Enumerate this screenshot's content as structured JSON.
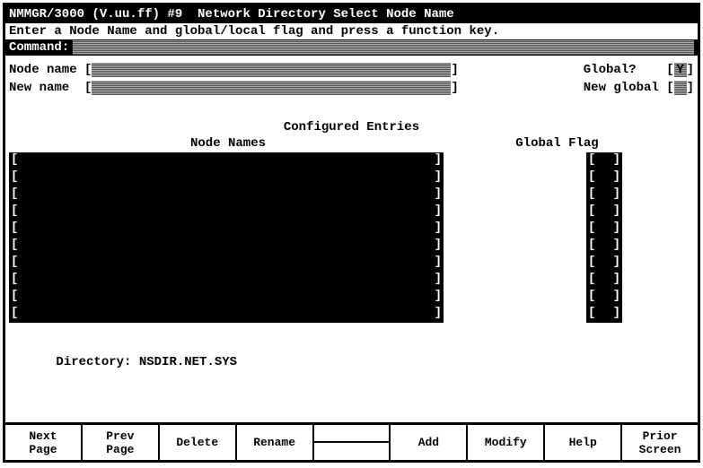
{
  "header": {
    "title": "NMMGR/3000 (V.uu.ff) #9  Network Directory Select Node Name",
    "instruction": "Enter a Node Name and global/local flag and press a function key.",
    "command_label": "Command:"
  },
  "fields": {
    "node_name_label": "Node name ",
    "new_name_label": "New name  ",
    "global_label": "Global?    ",
    "global_value": "Y",
    "new_global_label": "New global "
  },
  "section": {
    "title": "Configured Entries",
    "col_names": "Node Names",
    "col_flag": "Global Flag"
  },
  "entries": [
    {
      "name": "",
      "flag": ""
    },
    {
      "name": "",
      "flag": ""
    },
    {
      "name": "",
      "flag": ""
    },
    {
      "name": "",
      "flag": ""
    },
    {
      "name": "",
      "flag": ""
    },
    {
      "name": "",
      "flag": ""
    },
    {
      "name": "",
      "flag": ""
    },
    {
      "name": "",
      "flag": ""
    },
    {
      "name": "",
      "flag": ""
    },
    {
      "name": "",
      "flag": ""
    }
  ],
  "directory": {
    "label": "Directory: ",
    "value": "NSDIR.NET.SYS"
  },
  "fkeys": {
    "f1a": "Next",
    "f1b": "Page",
    "f2a": "Prev",
    "f2b": "Page",
    "f3": "Delete",
    "f4": "Rename",
    "f5": "",
    "f6": "Add",
    "f7": "Modify",
    "f8": "Help",
    "f9a": "Prior",
    "f9b": "Screen"
  }
}
